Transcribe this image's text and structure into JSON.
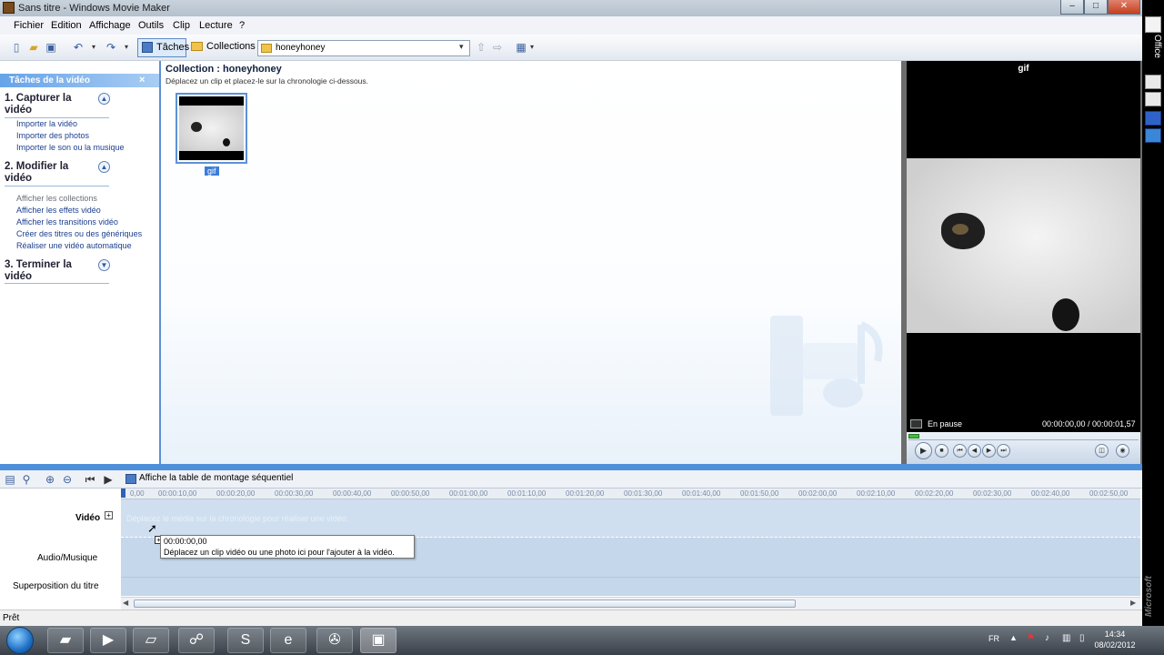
{
  "window": {
    "title": "Sans titre - Windows Movie Maker"
  },
  "menu": [
    "Fichier",
    "Edition",
    "Affichage",
    "Outils",
    "Clip",
    "Lecture",
    "?"
  ],
  "toolbar": {
    "tasks_label": "Tâches",
    "collections_label": "Collections",
    "collection_value": "honeyhoney"
  },
  "tasks": {
    "header": "Tâches de la vidéo",
    "close": "×",
    "sections": [
      {
        "title": "1. Capturer la vidéo",
        "links": [
          "Importer la vidéo",
          "Importer des photos",
          "Importer le son ou la musique"
        ]
      },
      {
        "title": "2. Modifier la vidéo",
        "links": [
          "Afficher les collections",
          "Afficher les effets vidéo",
          "Afficher les transitions vidéo",
          "Créer des titres ou des génériques",
          "Réaliser une vidéo automatique"
        ]
      },
      {
        "title": "3. Terminer la vidéo",
        "links": []
      }
    ]
  },
  "collection": {
    "title": "Collection : honeyhoney",
    "hint": "Déplacez un clip et placez-le sur la chronologie ci-dessous.",
    "clips": [
      {
        "label": "gif"
      }
    ]
  },
  "preview": {
    "title": "gif",
    "status": "En pause",
    "time": "00:00:00,00 / 00:00:01,57"
  },
  "timeline": {
    "toggle_label": "Affiche la table de montage séquentiel",
    "ruler": [
      "0,00",
      "00:00:10,00",
      "00:00:20,00",
      "00:00:30,00",
      "00:00:40,00",
      "00:00:50,00",
      "00:01:00,00",
      "00:01:10,00",
      "00:01:20,00",
      "00:01:30,00",
      "00:01:40,00",
      "00:01:50,00",
      "00:02:00,00",
      "00:02:10,00",
      "00:02:20,00",
      "00:02:30,00",
      "00:02:40,00",
      "00:02:50,00"
    ],
    "tracks": {
      "video": "Vidéo",
      "audio": "Audio/Musique",
      "title": "Superposition du titre"
    },
    "drop_hint": "Déplacez le média sur la chronologie pour réaliser une vidéo.",
    "tooltip_time": "00:00:00,00",
    "tooltip_text": "Déplacez un clip vidéo ou une photo ici pour l'ajouter à la vidéo."
  },
  "status": "Prêt",
  "officebar": {
    "label": "Office",
    "brand": "Microsoft"
  },
  "taskbar": {
    "lang": "FR",
    "time": "14:34",
    "date": "08/02/2012"
  }
}
